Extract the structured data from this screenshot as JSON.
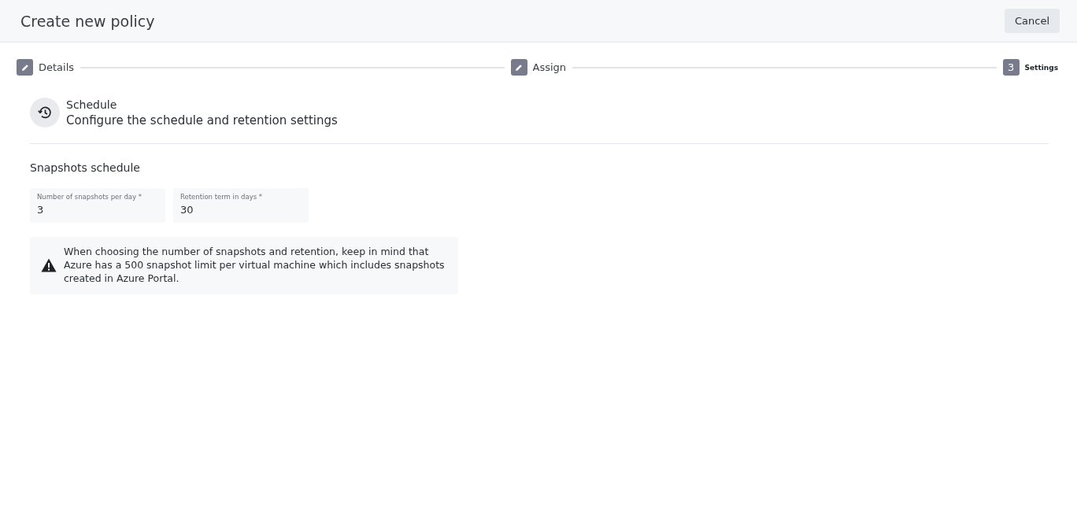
{
  "header": {
    "title": "Create new policy",
    "cancel_button": "Cancel"
  },
  "steps": [
    {
      "kind": "completed",
      "label": "Details"
    },
    {
      "kind": "completed",
      "label": "Assign"
    },
    {
      "kind": "current",
      "number": "3",
      "label": "Settings"
    }
  ],
  "section": {
    "title": "Schedule",
    "subtitle": "Configure the schedule and retention settings"
  },
  "snapshots": {
    "heading": "Snapshots schedule",
    "fields": [
      {
        "label": "Number of snapshots per day *",
        "value": "3"
      },
      {
        "label": "Retention term in days *",
        "value": "30"
      }
    ],
    "warning": "When choosing the number of snapshots and retention, keep in mind that Azure has a 500 snapshot limit per virtual machine which includes snapshots created in Azure Portal."
  }
}
